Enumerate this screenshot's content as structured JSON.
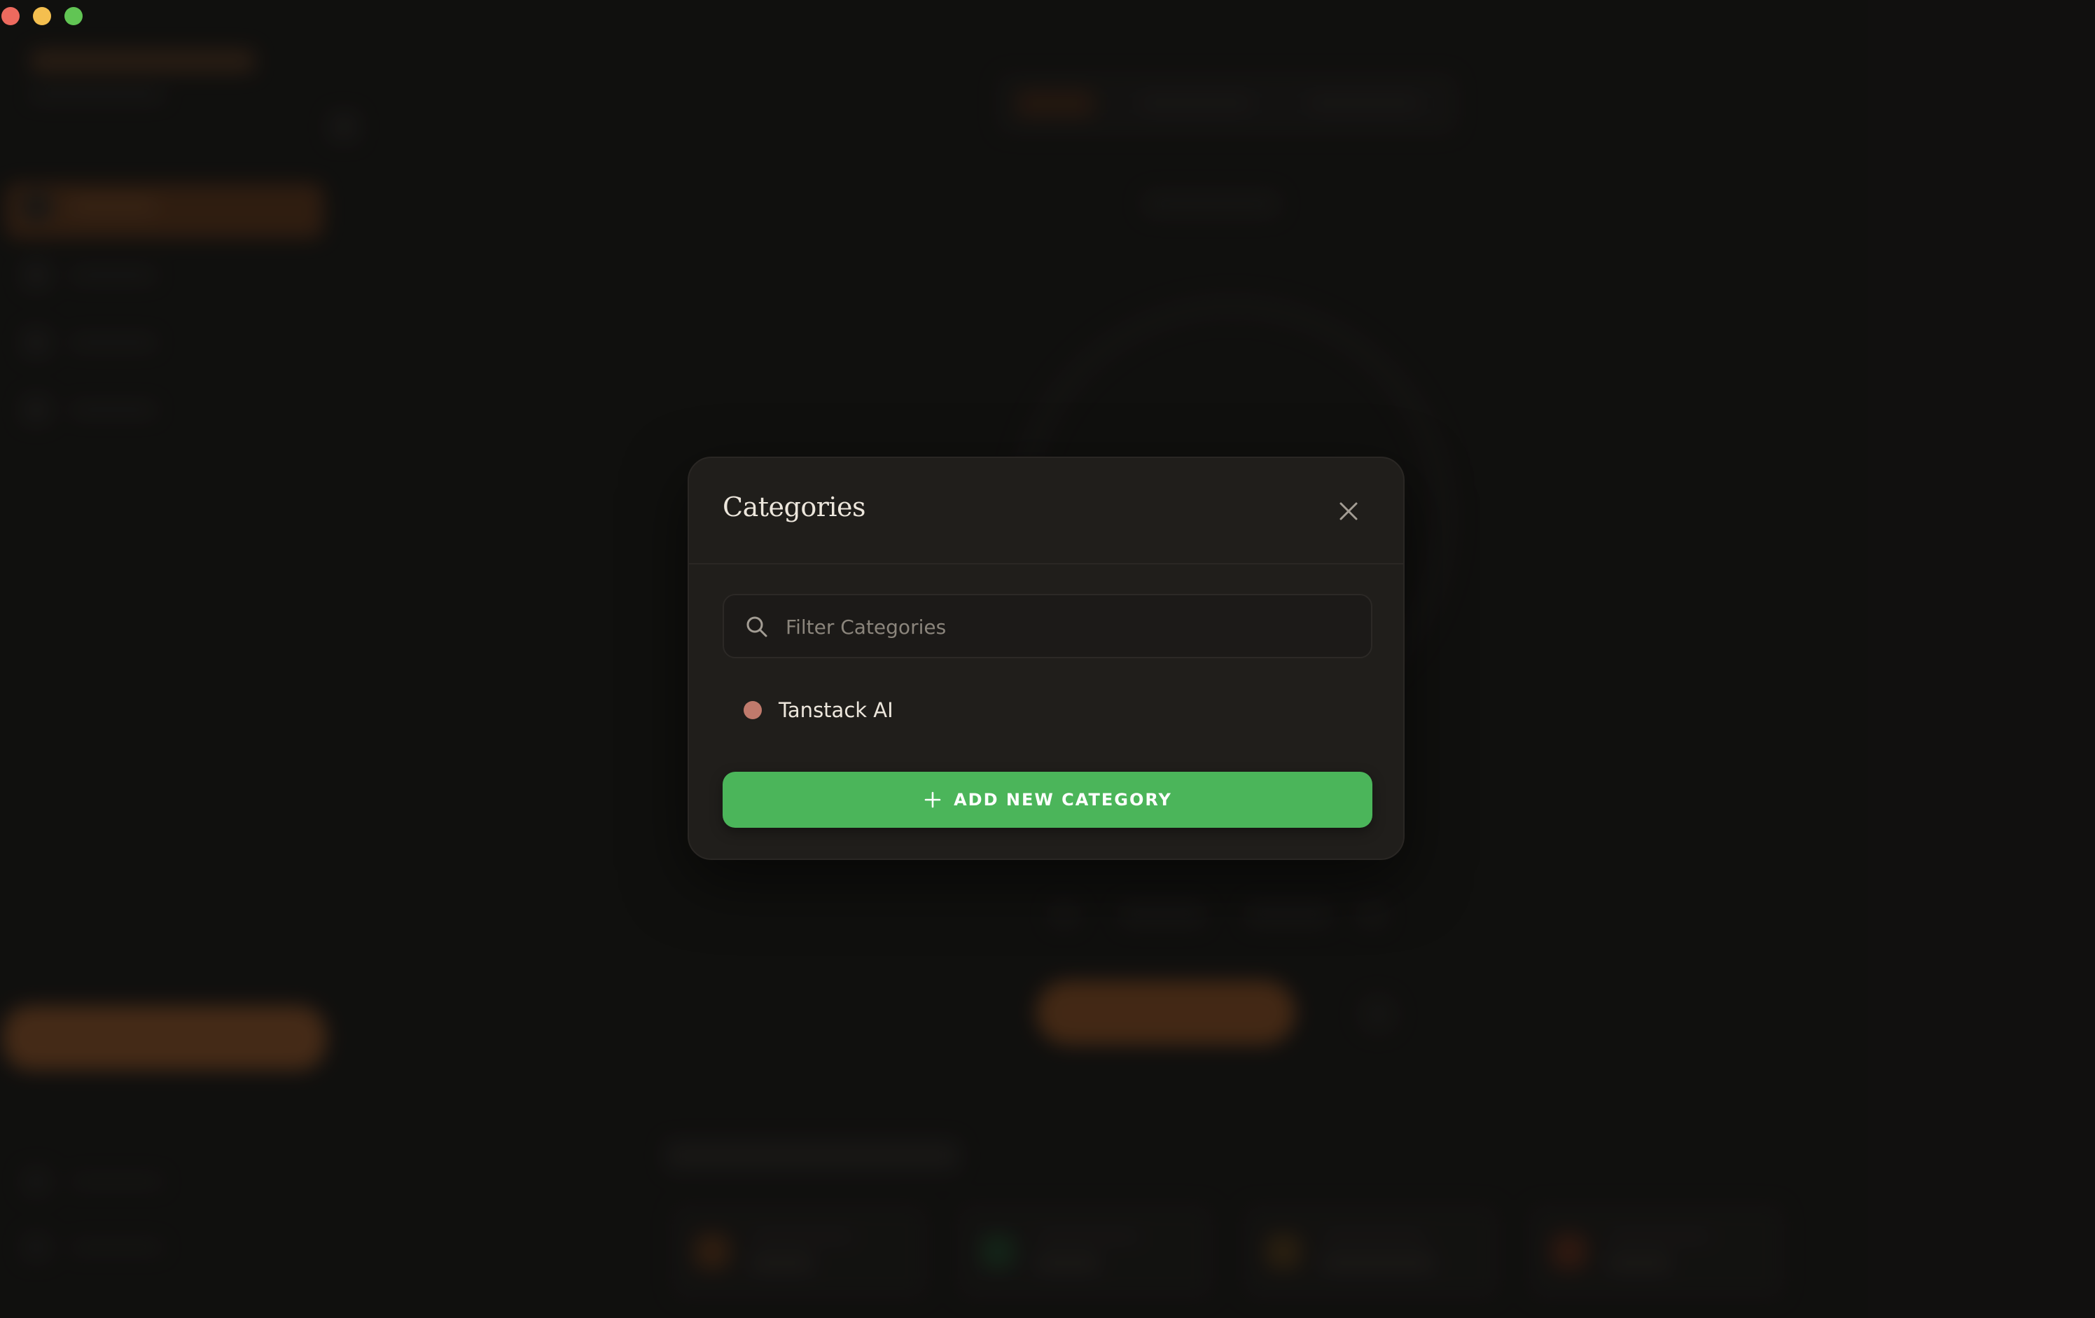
{
  "window": {
    "controls": [
      "close",
      "minimize",
      "zoom"
    ]
  },
  "modal": {
    "title": "Categories",
    "close_icon": "close-icon",
    "search": {
      "placeholder": "Filter Categories",
      "value": "",
      "icon": "search-icon"
    },
    "categories": [
      {
        "label": "Tanstack AI",
        "color": "#c07a6c"
      }
    ],
    "add_button": {
      "label": "ADD NEW CATEGORY",
      "icon": "plus-icon",
      "color": "#4bb55a"
    }
  },
  "colors": {
    "accent": "#a85f2b",
    "background": "#151412",
    "modal_surface": "#201e1b",
    "success": "#4bb55a"
  }
}
